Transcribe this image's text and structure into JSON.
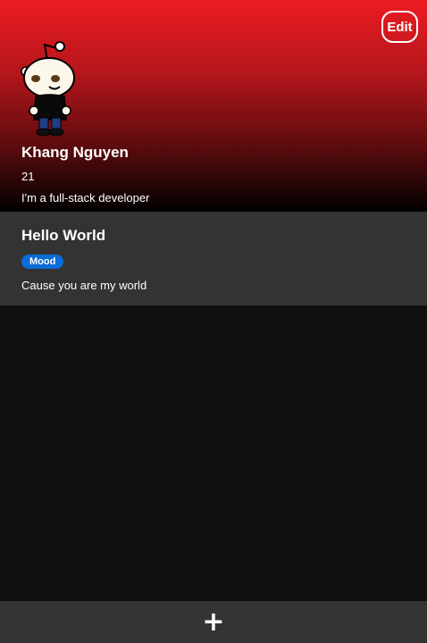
{
  "profile": {
    "edit_label": "Edit",
    "name": "Khang Nguyen",
    "age": "21",
    "bio": "I'm a full-stack developer"
  },
  "posts": [
    {
      "title": "Hello World",
      "tag": "Mood",
      "body": "Cause you are my world"
    }
  ],
  "bottom_bar": {
    "add_label": "+"
  },
  "colors": {
    "header_top": "#ec1c22",
    "header_bottom": "#000000",
    "card_bg": "#333333",
    "page_bg": "#0f0f0f",
    "tag_bg": "#0a6cd6"
  },
  "icons": {
    "avatar": "reddit-snoo-avatar",
    "add": "plus-icon"
  }
}
